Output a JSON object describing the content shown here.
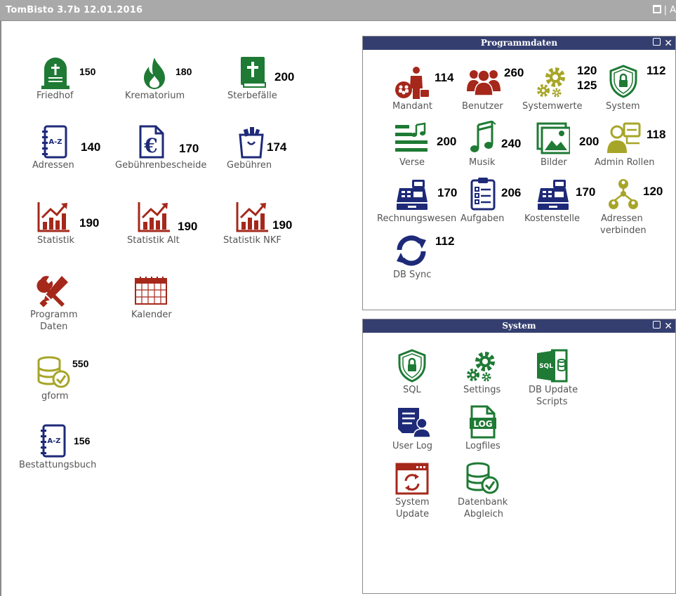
{
  "window": {
    "title": "TomBisto 3.7b 12.01.2016",
    "right_tail": "| A"
  },
  "colors": {
    "green": "#1e7a34",
    "red": "#a5281b",
    "navy": "#1e2a78",
    "olive": "#a7a528",
    "header": "#343f70"
  },
  "main": {
    "tiles": [
      {
        "id": "friedhof",
        "label": "Friedhof",
        "number": "150",
        "icon": "gravestone-icon"
      },
      {
        "id": "krematorium",
        "label": "Krematorium",
        "number": "180",
        "icon": "flame-icon"
      },
      {
        "id": "sterbefaelle",
        "label": "Sterbefälle",
        "number": "200",
        "icon": "bible-icon"
      },
      {
        "id": "adressen",
        "label": "Adressen",
        "number": "140",
        "icon": "address-book-icon"
      },
      {
        "id": "gebuehrenbescheide",
        "label": "Gebührenbescheide",
        "number": "170",
        "icon": "euro-document-icon"
      },
      {
        "id": "gebuehren",
        "label": "Gebühren",
        "number": "174",
        "icon": "shopping-bag-icon"
      },
      {
        "id": "statistik",
        "label": "Statistik",
        "number": "190",
        "icon": "bar-chart-icon"
      },
      {
        "id": "statistik-alt",
        "label": "Statistik Alt",
        "number": "190",
        "icon": "bar-chart-icon"
      },
      {
        "id": "statistik-nkf",
        "label": "Statistik NKF",
        "number": "190",
        "icon": "bar-chart-icon"
      },
      {
        "id": "programm-daten",
        "label": "Programm Daten",
        "label_line1": "Programm",
        "label_line2": "Daten",
        "number": "",
        "icon": "tools-icon"
      },
      {
        "id": "kalender",
        "label": "Kalender",
        "number": "",
        "icon": "calendar-icon"
      },
      {
        "id": "gform",
        "label": "gform",
        "number": "550",
        "icon": "database-check-icon"
      },
      {
        "id": "bestattungsbuch",
        "label": "Bestattungsbuch",
        "number": "156",
        "icon": "address-book-icon"
      }
    ]
  },
  "programmdaten": {
    "title": "Programmdaten",
    "tiles": [
      {
        "id": "mandant",
        "label": "Mandant",
        "number": "114",
        "icon": "businessman-icon"
      },
      {
        "id": "benutzer",
        "label": "Benutzer",
        "number": "260",
        "icon": "users-icon"
      },
      {
        "id": "systemwerte",
        "label": "Systemwerte",
        "number": "120",
        "number2": "125",
        "icon": "gears-icon"
      },
      {
        "id": "system",
        "label": "System",
        "number": "112",
        "icon": "shield-lock-icon"
      },
      {
        "id": "verse",
        "label": "Verse",
        "number": "200",
        "icon": "text-music-icon"
      },
      {
        "id": "musik",
        "label": "Musik",
        "number": "240",
        "icon": "music-note-icon"
      },
      {
        "id": "bilder",
        "label": "Bilder",
        "number": "200",
        "icon": "pictures-icon"
      },
      {
        "id": "admin-rollen",
        "label": "Admin Rollen",
        "number": "118",
        "icon": "admin-roles-icon"
      },
      {
        "id": "rechnungswesen",
        "label": "Rechnungswesen",
        "number": "170",
        "icon": "cash-register-icon"
      },
      {
        "id": "aufgaben",
        "label": "Aufgaben",
        "number": "206",
        "icon": "clipboard-checklist-icon"
      },
      {
        "id": "kostenstelle",
        "label": "Kostenstelle",
        "number": "170",
        "icon": "cash-register-icon"
      },
      {
        "id": "adressen-verbinden",
        "label": "Adressen verbinden",
        "label_line1": "Adressen",
        "label_line2": "verbinden",
        "number": "120",
        "icon": "network-people-icon"
      },
      {
        "id": "db-sync",
        "label": "DB Sync",
        "number": "112",
        "icon": "sync-icon"
      }
    ]
  },
  "system": {
    "title": "System",
    "tiles": [
      {
        "id": "sql",
        "label": "SQL",
        "icon": "shield-lock-icon"
      },
      {
        "id": "settings",
        "label": "Settings",
        "icon": "gears-icon"
      },
      {
        "id": "db-update-scripts",
        "label": "DB Update Scripts",
        "label_line1": "DB Update",
        "label_line2": "Scripts",
        "icon": "sql-database-icon",
        "icon_text": "SQL"
      },
      {
        "id": "user-log",
        "label": "User Log",
        "icon": "user-log-icon"
      },
      {
        "id": "logfiles",
        "label": "Logfiles",
        "icon": "log-file-icon",
        "icon_text": "LOG"
      },
      {
        "id": "system-update",
        "label": "System Update",
        "label_line1": "System",
        "label_line2": "Update",
        "icon": "update-window-icon"
      },
      {
        "id": "datenbank-abgleich",
        "label": "Datenbank Abgleich",
        "label_line1": "Datenbank",
        "label_line2": "Abgleich",
        "icon": "database-check-icon"
      }
    ]
  }
}
